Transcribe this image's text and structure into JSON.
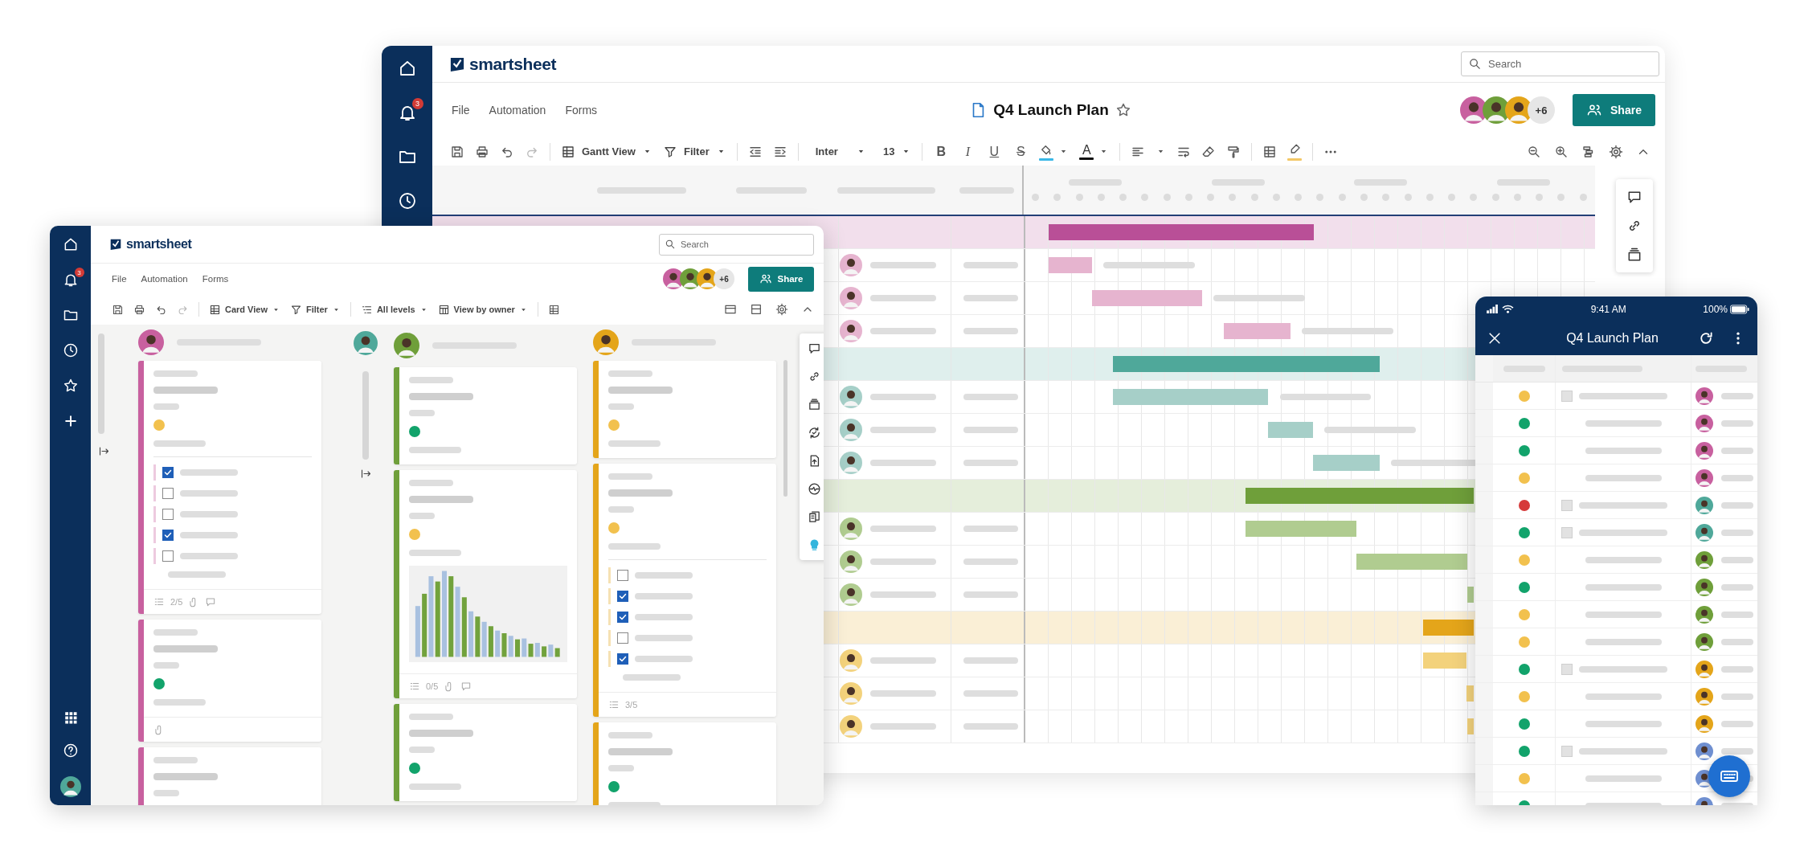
{
  "main_window": {
    "notification_count": "3",
    "brand": "smartsheet",
    "search": {
      "placeholder": "Search"
    },
    "menu": [
      "File",
      "Automation",
      "Forms"
    ],
    "sheet_title": "Q4 Launch Plan",
    "collaborators": [
      {
        "color": "#c8609f"
      },
      {
        "color": "#6f9f3a"
      },
      {
        "color": "#e4a51a"
      }
    ],
    "more_collaborators": "+6",
    "share_button": "Share",
    "toolbar": {
      "view": "Gantt View",
      "filter": "Filter",
      "font": "Inter",
      "font_size": "13",
      "text_styles": [
        "B",
        "I",
        "U",
        "S"
      ],
      "font_color_letter": "A"
    },
    "gantt_rows": [
      {
        "kind": "group",
        "color": "#b94f97"
      },
      {
        "kind": "task",
        "color": "#e6b4cf"
      },
      {
        "kind": "task",
        "color": "#e6b4cf"
      },
      {
        "kind": "task",
        "color": "#e6b4cf"
      },
      {
        "kind": "group",
        "color": "#4fa89a"
      },
      {
        "kind": "task",
        "color": "#a6cfc8"
      },
      {
        "kind": "task",
        "color": "#a6cfc8"
      },
      {
        "kind": "task",
        "color": "#a6cfc8"
      },
      {
        "kind": "group",
        "color": "#6f9f3a"
      },
      {
        "kind": "task",
        "color": "#b0cc90"
      },
      {
        "kind": "task",
        "color": "#b0cc90"
      },
      {
        "kind": "task",
        "color": "#b0cc90"
      },
      {
        "kind": "group",
        "color": "#e4a51a"
      },
      {
        "kind": "task",
        "color": "#f3d27c"
      },
      {
        "kind": "task",
        "color": "#f3d27c"
      },
      {
        "kind": "task",
        "color": "#f3d27c"
      }
    ]
  },
  "card_window": {
    "notification_count": "3",
    "brand": "smartsheet",
    "search": {
      "placeholder": "Search"
    },
    "menu": [
      "File",
      "Automation",
      "Forms"
    ],
    "collaborators": [
      {
        "color": "#c8609f"
      },
      {
        "color": "#6f9f3a"
      },
      {
        "color": "#e4a51a"
      }
    ],
    "more_collaborators": "+6",
    "share_button": "Share",
    "toolbar": {
      "view": "Card View",
      "filter": "Filter",
      "levels": "All levels",
      "grouping": "View by owner"
    },
    "user_avatar": {
      "color": "#4fa89a"
    },
    "collapsed_lane": {
      "color": "#4fa89a"
    },
    "lanes": [
      {
        "color": "#c8609f",
        "cards": [
          {
            "kind": "checklist",
            "status": {
              "color": "#f2c14e"
            },
            "items": [
              {
                "checked": true
              },
              {
                "checked": false
              },
              {
                "checked": false
              },
              {
                "checked": true
              },
              {
                "checked": false
              }
            ],
            "footer": {
              "progress": "2/5",
              "attachment": true,
              "comments": true
            }
          },
          {
            "kind": "status",
            "status": {
              "color": "#12a36b"
            },
            "footer": {
              "attachment": true,
              "comments": false
            }
          },
          {
            "kind": "plain"
          }
        ]
      },
      {
        "color": "#6f9f3a",
        "cards": [
          {
            "kind": "status",
            "status": {
              "color": "#12a36b"
            }
          },
          {
            "kind": "chart",
            "status": {
              "color": "#f2c14e"
            },
            "footer": {
              "progress": "0/5",
              "attachment": true,
              "comments": true
            }
          },
          {
            "kind": "status",
            "status": {
              "color": "#12a36b"
            }
          }
        ]
      },
      {
        "color": "#e4a51a",
        "cards": [
          {
            "kind": "status",
            "status": {
              "color": "#f2c14e"
            }
          },
          {
            "kind": "checklist",
            "status": {
              "color": "#f2c14e"
            },
            "items": [
              {
                "checked": false
              },
              {
                "checked": true
              },
              {
                "checked": true
              },
              {
                "checked": false
              },
              {
                "checked": true
              }
            ],
            "footer": {
              "progress": "3/5",
              "attachment": false,
              "comments": false
            }
          },
          {
            "kind": "status",
            "status": {
              "color": "#12a36b"
            }
          }
        ]
      }
    ]
  },
  "mobile": {
    "time": "9:41 AM",
    "battery": "100%",
    "title": "Q4 Launch Plan",
    "rows": [
      {
        "status": {
          "color": "#f2c14e"
        },
        "expandable": true,
        "owner": {
          "color": "#c8609f"
        }
      },
      {
        "status": {
          "color": "#12a36b"
        },
        "expandable": false,
        "owner": {
          "color": "#c8609f"
        }
      },
      {
        "status": {
          "color": "#12a36b"
        },
        "expandable": false,
        "owner": {
          "color": "#c8609f"
        }
      },
      {
        "status": {
          "color": "#f2c14e"
        },
        "expandable": false,
        "owner": {
          "color": "#c8609f"
        }
      },
      {
        "status": {
          "color": "#d63a3a"
        },
        "expandable": true,
        "owner": {
          "color": "#4fa89a"
        }
      },
      {
        "status": {
          "color": "#12a36b"
        },
        "expandable": true,
        "owner": {
          "color": "#4fa89a"
        }
      },
      {
        "status": {
          "color": "#f2c14e"
        },
        "expandable": false,
        "owner": {
          "color": "#6f9f3a"
        }
      },
      {
        "status": {
          "color": "#12a36b"
        },
        "expandable": false,
        "owner": {
          "color": "#6f9f3a"
        }
      },
      {
        "status": {
          "color": "#f2c14e"
        },
        "expandable": false,
        "owner": {
          "color": "#6f9f3a"
        }
      },
      {
        "status": {
          "color": "#f2c14e"
        },
        "expandable": false,
        "owner": {
          "color": "#6f9f3a"
        }
      },
      {
        "status": {
          "color": "#12a36b"
        },
        "expandable": true,
        "owner": {
          "color": "#e4a51a"
        }
      },
      {
        "status": {
          "color": "#f2c14e"
        },
        "expandable": false,
        "owner": {
          "color": "#e4a51a"
        }
      },
      {
        "status": {
          "color": "#12a36b"
        },
        "expandable": false,
        "owner": {
          "color": "#e4a51a"
        }
      },
      {
        "status": {
          "color": "#12a36b"
        },
        "expandable": true,
        "owner": {
          "color": "#6f8fd0"
        }
      },
      {
        "status": {
          "color": "#f2c14e"
        },
        "expandable": false,
        "owner": {
          "color": "#6f8fd0"
        }
      },
      {
        "status": {
          "color": "#12a36b"
        },
        "expandable": false,
        "owner": {
          "color": "#6f8fd0"
        }
      }
    ]
  }
}
